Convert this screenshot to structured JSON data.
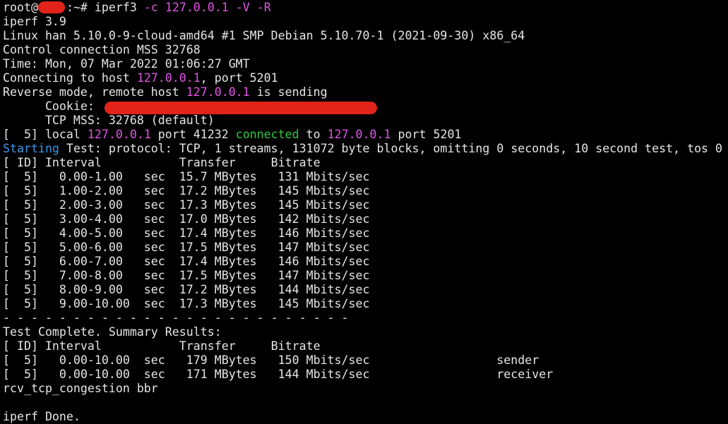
{
  "colors": {
    "background": "#000000",
    "foreground": "#e6e6e6",
    "host_highlight": "#e155e6",
    "status_blue": "#3a96e8",
    "status_green": "#2ec940",
    "redaction": "#e2231a"
  },
  "prompt": {
    "user_prefix": "root@",
    "suffix": ":~# ",
    "command": "iperf3",
    "args": "-c 127.0.0.1 -V -R"
  },
  "header": {
    "version": "iperf 3.9",
    "uname": "Linux han 5.10.0-9-cloud-amd64 #1 SMP Debian 5.10.70-1 (2021-09-30) x86_64",
    "mss": "Control connection MSS 32768",
    "time": "Time: Mon, 07 Mar 2022 01:06:27 GMT",
    "connecting_prefix": "Connecting to host ",
    "connecting_host": "127.0.0.1",
    "connecting_suffix": ", port 5201",
    "reverse_prefix": "Reverse mode, remote host ",
    "reverse_host": "127.0.0.1",
    "reverse_suffix": " is sending",
    "cookie_label": "      Cookie: ",
    "tcp_mss": "      TCP MSS: 32768 (default)"
  },
  "connection": {
    "prefix": "[  5] local ",
    "local_host": "127.0.0.1",
    "local_port": " port 41232 ",
    "status": "connected",
    "to": " to ",
    "remote_host": "127.0.0.1",
    "remote_port": " port 5201"
  },
  "starting": {
    "label": "Starting",
    "text": " Test: protocol: TCP, 1 streams, 131072 byte blocks, omitting 0 seconds, 10 second test, tos 0"
  },
  "interval_header": "[ ID] Interval           Transfer     Bitrate",
  "intervals": [
    "[  5]   0.00-1.00   sec  15.7 MBytes   131 Mbits/sec",
    "[  5]   1.00-2.00   sec  17.2 MBytes   145 Mbits/sec",
    "[  5]   2.00-3.00   sec  17.3 MBytes   145 Mbits/sec",
    "[  5]   3.00-4.00   sec  17.0 MBytes   142 Mbits/sec",
    "[  5]   4.00-5.00   sec  17.4 MBytes   146 Mbits/sec",
    "[  5]   5.00-6.00   sec  17.5 MBytes   147 Mbits/sec",
    "[  5]   6.00-7.00   sec  17.4 MBytes   146 Mbits/sec",
    "[  5]   7.00-8.00   sec  17.5 MBytes   147 Mbits/sec",
    "[  5]   8.00-9.00   sec  17.2 MBytes   144 Mbits/sec",
    "[  5]   9.00-10.00  sec  17.3 MBytes   145 Mbits/sec"
  ],
  "separator": "- - - - - - - - - - - - - - - - - - - - - - - - -",
  "summary": {
    "title": "Test Complete. Summary Results:",
    "header": "[ ID] Interval           Transfer     Bitrate",
    "rows": [
      "[  5]   0.00-10.00  sec   179 MBytes   150 Mbits/sec                  sender",
      "[  5]   0.00-10.00  sec   171 MBytes   144 Mbits/sec                  receiver"
    ]
  },
  "congestion": "rcv_tcp_congestion bbr",
  "done": "iperf Done."
}
